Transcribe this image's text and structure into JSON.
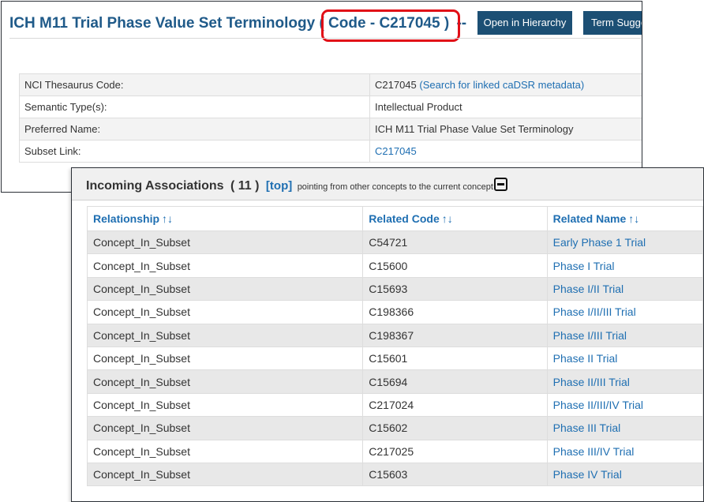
{
  "header": {
    "title": "ICH M11 Trial Phase Value Set Terminology",
    "code_label": "( Code - C217045 )",
    "title_suffix": "--",
    "buttons": {
      "open_hierarchy": "Open in Hierarchy",
      "term_suggestion": "Term Sugge"
    },
    "highlight_color": "#e10f17",
    "title_color": "#1f5a89"
  },
  "properties": [
    {
      "label": "NCI Thesaurus Code:",
      "value": "C217045",
      "link": "(Search for linked caDSR metadata)"
    },
    {
      "label": "Semantic Type(s):",
      "value": "Intellectual Product"
    },
    {
      "label": "Preferred Name:",
      "value": "ICH M11 Trial Phase Value Set Terminology"
    },
    {
      "label": "Subset Link:",
      "link_value": "C217045"
    }
  ],
  "incoming": {
    "title": "Incoming Associations",
    "count": "( 11 )",
    "top_link": "[top]",
    "note": "pointing from other concepts to the current concept",
    "collapse_icon": "minus-square-icon",
    "columns": [
      "Relationship",
      "Related Code",
      "Related Name"
    ],
    "sort_glyph": "↑↓",
    "rows": [
      {
        "relationship": "Concept_In_Subset",
        "code": "C54721",
        "name": "Early Phase 1 Trial"
      },
      {
        "relationship": "Concept_In_Subset",
        "code": "C15600",
        "name": "Phase I Trial"
      },
      {
        "relationship": "Concept_In_Subset",
        "code": "C15693",
        "name": "Phase I/II Trial"
      },
      {
        "relationship": "Concept_In_Subset",
        "code": "C198366",
        "name": "Phase I/II/III Trial"
      },
      {
        "relationship": "Concept_In_Subset",
        "code": "C198367",
        "name": "Phase I/III Trial"
      },
      {
        "relationship": "Concept_In_Subset",
        "code": "C15601",
        "name": "Phase II Trial"
      },
      {
        "relationship": "Concept_In_Subset",
        "code": "C15694",
        "name": "Phase II/III Trial"
      },
      {
        "relationship": "Concept_In_Subset",
        "code": "C217024",
        "name": "Phase II/III/IV Trial"
      },
      {
        "relationship": "Concept_In_Subset",
        "code": "C15602",
        "name": "Phase III Trial"
      },
      {
        "relationship": "Concept_In_Subset",
        "code": "C217025",
        "name": "Phase III/IV Trial"
      },
      {
        "relationship": "Concept_In_Subset",
        "code": "C15603",
        "name": "Phase IV Trial"
      }
    ],
    "link_color": "#1f6fb2"
  }
}
